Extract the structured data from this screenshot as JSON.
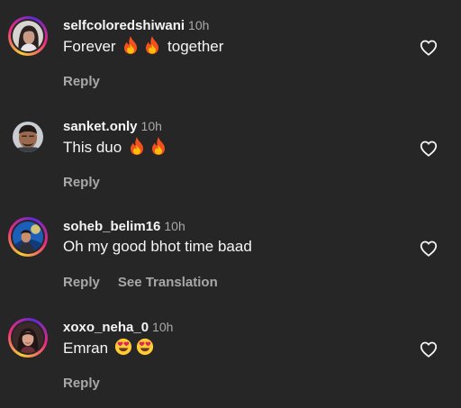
{
  "comments": [
    {
      "username": "selfcoloredshiwani",
      "time": "10h",
      "text_before": "Forever",
      "emojis": [
        "fire-emoji",
        "fire-emoji"
      ],
      "text_after": "together",
      "reply": "Reply",
      "translation": "",
      "story_ring": true
    },
    {
      "username": "sanket.only",
      "time": "10h",
      "text_before": "This duo",
      "emojis": [
        "fire-emoji",
        "fire-emoji"
      ],
      "text_after": "",
      "reply": "Reply",
      "translation": "",
      "story_ring": false
    },
    {
      "username": "soheb_belim16",
      "time": "10h",
      "text_before": "Oh my good bhot time baad",
      "emojis": [],
      "text_after": "",
      "reply": "Reply",
      "translation": "See Translation",
      "story_ring": true
    },
    {
      "username": "xoxo_neha_0",
      "time": "10h",
      "text_before": "Emran",
      "emojis": [
        "heart-eyes-emoji",
        "heart-eyes-emoji"
      ],
      "text_after": "",
      "reply": "Reply",
      "translation": "",
      "story_ring": true
    }
  ],
  "colors": {
    "background": "#262626",
    "text": "#f5f5f5",
    "secondary_text": "#a8a8a8",
    "like_icon": "#f5f5f5"
  },
  "icons": {
    "like": "heart-outline-icon"
  }
}
